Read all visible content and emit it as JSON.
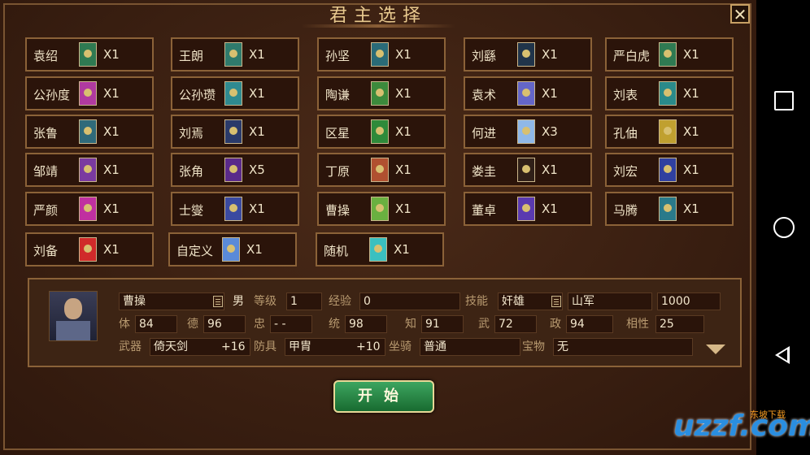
{
  "window": {
    "title": "君主选择",
    "close_symbol": "✕"
  },
  "lords": [
    {
      "name": "袁绍",
      "count": "X1",
      "color": "#2f7a52"
    },
    {
      "name": "王朗",
      "count": "X1",
      "color": "#2f7a6c"
    },
    {
      "name": "孙坚",
      "count": "X1",
      "color": "#2a6b78"
    },
    {
      "name": "刘繇",
      "count": "X1",
      "color": "#20344a"
    },
    {
      "name": "严白虎",
      "count": "X1",
      "color": "#2f7a52"
    },
    {
      "name": "公孙度",
      "count": "X1",
      "color": "#b03aa0"
    },
    {
      "name": "公孙瓒",
      "count": "X1",
      "color": "#2f8a90"
    },
    {
      "name": "陶谦",
      "count": "X1",
      "color": "#3c8a3c"
    },
    {
      "name": "袁术",
      "count": "X1",
      "color": "#6466c8"
    },
    {
      "name": "刘表",
      "count": "X1",
      "color": "#2a8a8a"
    },
    {
      "name": "张鲁",
      "count": "X1",
      "color": "#2f6a7a"
    },
    {
      "name": "刘焉",
      "count": "X1",
      "color": "#2a3a6a"
    },
    {
      "name": "区星",
      "count": "X1",
      "color": "#2e8a3a"
    },
    {
      "name": "何进",
      "count": "X3",
      "color": "#8fb8e8"
    },
    {
      "name": "孔伷",
      "count": "X1",
      "color": "#c0a030"
    },
    {
      "name": "邹靖",
      "count": "X1",
      "color": "#7a3aa0"
    },
    {
      "name": "张角",
      "count": "X5",
      "color": "#5a2a8a"
    },
    {
      "name": "丁原",
      "count": "X1",
      "color": "#b05030"
    },
    {
      "name": "娄圭",
      "count": "X1",
      "color": "#302018"
    },
    {
      "name": "刘宏",
      "count": "X1",
      "color": "#3040a0"
    },
    {
      "name": "严颜",
      "count": "X1",
      "color": "#c030a0"
    },
    {
      "name": "士燮",
      "count": "X1",
      "color": "#3a4aa0"
    },
    {
      "name": "曹操",
      "count": "X1",
      "color": "#6ab040"
    },
    {
      "name": "董卓",
      "count": "X1",
      "color": "#5a3ab0"
    },
    {
      "name": "马腾",
      "count": "X1",
      "color": "#2a7a8a"
    },
    {
      "name": "刘备",
      "count": "X1",
      "color": "#d02a2a"
    },
    {
      "name": "自定义",
      "count": "X1",
      "color": "#5a8ad8"
    },
    {
      "name": "随机",
      "count": "X1",
      "color": "#3ac0c0"
    }
  ],
  "info": {
    "name": "曹操",
    "gender": "男",
    "level_label": "等级",
    "level": "1",
    "exp_label": "经验",
    "exp": "0",
    "skill_label": "技能",
    "skill": "奸雄",
    "troop": "山军",
    "troop_num": "1000",
    "stats": [
      {
        "label": "体",
        "value": "84"
      },
      {
        "label": "德",
        "value": "96"
      },
      {
        "label": "忠",
        "value": "- -"
      },
      {
        "label": "统",
        "value": "98"
      },
      {
        "label": "知",
        "value": "91"
      },
      {
        "label": "武",
        "value": "72"
      },
      {
        "label": "政",
        "value": "94"
      },
      {
        "label": "相性",
        "value": "25"
      }
    ],
    "weapon_label": "武器",
    "weapon": "倚天剑",
    "weapon_bonus": "+16",
    "armor_label": "防具",
    "armor": "甲胄",
    "armor_bonus": "+10",
    "mount_label": "坐骑",
    "mount": "普通",
    "treasure_label": "宝物",
    "treasure": "无"
  },
  "start_button": "开始",
  "watermark": {
    "main": "uzzf.com",
    "sub": "东坡下载"
  }
}
